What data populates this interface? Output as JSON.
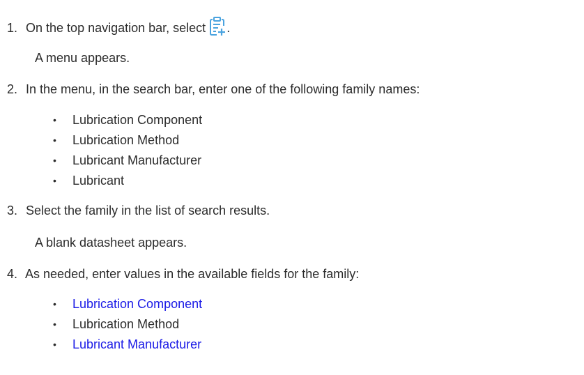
{
  "steps": [
    {
      "number": "1.",
      "text_before": "On the top navigation bar, select ",
      "icon": "new-record-icon",
      "text_after": ".",
      "result": "A menu appears."
    },
    {
      "number": "2.",
      "text": "In the menu, in the search bar, enter one of the following family names:",
      "bullets": [
        "Lubrication Component",
        "Lubrication Method",
        "Lubricant Manufacturer",
        "Lubricant"
      ]
    },
    {
      "number": "3.",
      "text": "Select the family in the list of search results.",
      "result": "A blank datasheet appears."
    },
    {
      "number": "4.",
      "text": "As needed, enter values in the available fields for the family:",
      "bullets": [
        {
          "label": "Lubrication Component",
          "is_link": true
        },
        {
          "label": "Lubrication Method",
          "is_link": false
        },
        {
          "label": "Lubricant Manufacturer",
          "is_link": true
        }
      ]
    }
  ],
  "colors": {
    "text": "#2b2b2b",
    "link": "#1a1ae6",
    "icon_blue": "#4aa3df"
  }
}
